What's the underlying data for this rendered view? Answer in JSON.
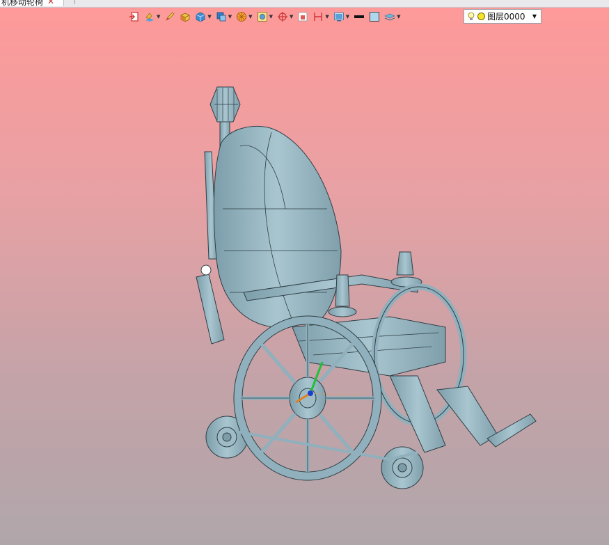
{
  "tab": {
    "title": "机移动轮椅",
    "close": "✕"
  },
  "toolbar": {
    "buttons": [
      {
        "name": "exit-sketch-icon",
        "dropdown": false
      },
      {
        "name": "render-style-icon",
        "dropdown": true
      },
      {
        "name": "pen-icon",
        "dropdown": false
      },
      {
        "name": "shaded-box-icon",
        "dropdown": false
      },
      {
        "name": "view-cube-icon",
        "dropdown": true
      },
      {
        "name": "standard-views-icon",
        "dropdown": true
      },
      {
        "name": "orient-compass-icon",
        "dropdown": true
      },
      {
        "name": "zoom-fit-icon",
        "dropdown": true
      },
      {
        "name": "snap-target-icon",
        "dropdown": true
      },
      {
        "name": "section-view-icon",
        "dropdown": false
      },
      {
        "name": "measure-icon",
        "dropdown": true
      },
      {
        "name": "display-settings-icon",
        "dropdown": true
      },
      {
        "name": "line-color-icon",
        "dropdown": false
      },
      {
        "name": "fill-color-icon",
        "dropdown": false
      },
      {
        "name": "layers-icon",
        "dropdown": true
      }
    ]
  },
  "layer": {
    "name": "图层0000",
    "arrow": "▼"
  },
  "colors": {
    "bg_top": "#ff9999",
    "bg_bottom": "#b0a6aa",
    "model": "#8fb0bc"
  }
}
